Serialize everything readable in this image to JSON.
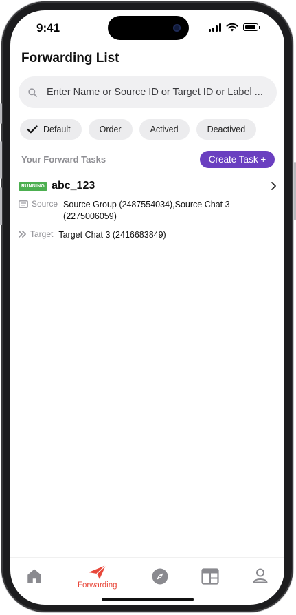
{
  "status_bar": {
    "time": "9:41"
  },
  "header": {
    "title": "Forwarding List"
  },
  "search": {
    "placeholder": "Enter Name or Source ID or Target ID or Label ..."
  },
  "filters": [
    {
      "label": "Default",
      "selected": true
    },
    {
      "label": "Order",
      "selected": false
    },
    {
      "label": "Actived",
      "selected": false
    },
    {
      "label": "Deactived",
      "selected": false
    }
  ],
  "tasks_section": {
    "label": "Your Forward Tasks",
    "create_button": "Create Task +"
  },
  "tasks": [
    {
      "status": "RUNNING",
      "name": "abc_123",
      "source_label": "Source",
      "source_value": "Source Group (2487554034),Source Chat 3 (2275006059)",
      "target_label": "Target",
      "target_value": "Target Chat 3 (2416683849)"
    }
  ],
  "bottom_nav": {
    "items": [
      {
        "icon": "home-icon",
        "label": ""
      },
      {
        "icon": "send-icon",
        "label": "Forwarding",
        "active": true
      },
      {
        "icon": "compass-icon",
        "label": ""
      },
      {
        "icon": "calendar-icon",
        "label": ""
      },
      {
        "icon": "profile-icon",
        "label": ""
      }
    ]
  },
  "colors": {
    "accent": "#6a3fc0",
    "active_nav": "#e8483b",
    "running_badge": "#4caf50",
    "muted_text": "#8e8e93",
    "chip_bg": "#ececee"
  }
}
